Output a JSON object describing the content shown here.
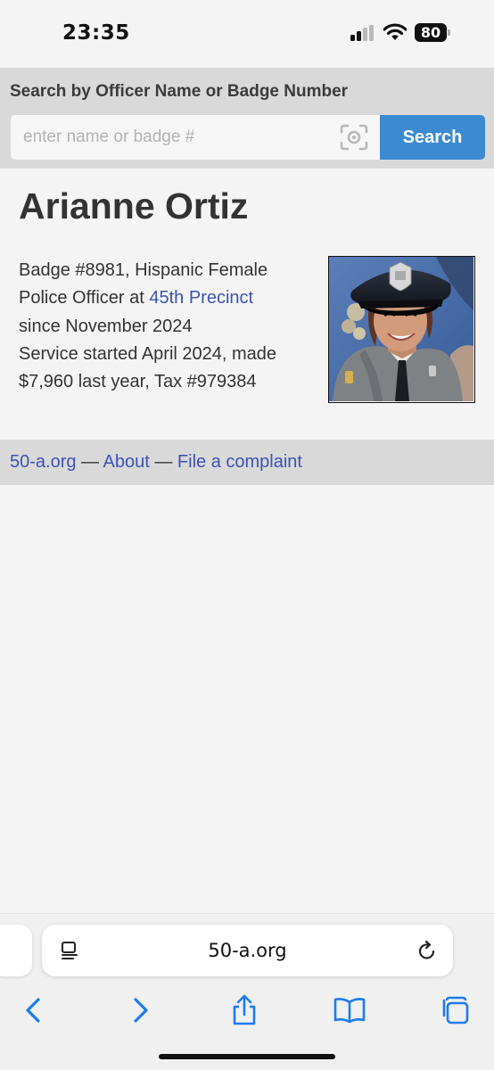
{
  "status_bar": {
    "time": "23:35",
    "battery_level": "80",
    "icons": [
      "cellular-signal-icon",
      "wifi-icon",
      "battery-icon"
    ]
  },
  "search": {
    "heading": "Search by Officer Name or Badge Number",
    "placeholder": "enter name or badge #",
    "value": "",
    "button_label": "Search",
    "button_color": "#3c8ad2",
    "icon": "visual-lookup-icon"
  },
  "officer": {
    "name": "Arianne Ortiz",
    "line1": "Badge #8981, Hispanic Female",
    "rank": "Police Officer at ",
    "precinct_link": "45th Precinct",
    "since": "since November 2024",
    "service_started": "Service started April 2024, made",
    "pay_tax": "$7,960 last year, Tax #979384",
    "photo": "officer-portrait-photo"
  },
  "footer": {
    "site_link": "50-a.org",
    "separator": " — ",
    "about_link": "About",
    "complaint_link": "File a complaint",
    "link_color": "#3d52b4"
  },
  "browser": {
    "url": "50-a.org",
    "toolbar": [
      "back-icon",
      "forward-icon",
      "share-icon",
      "bookmarks-icon",
      "tabs-icon"
    ],
    "accent_color": "#1b7cf2"
  }
}
